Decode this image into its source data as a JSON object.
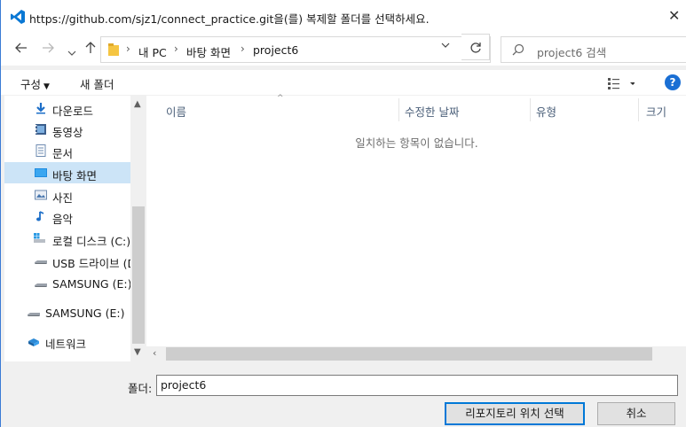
{
  "window": {
    "title": "https://github.com/sjz1/connect_practice.git을(를) 복제할 폴더를 선택하세요.",
    "close_glyph": "✕"
  },
  "nav": {
    "back_icon": "arrow-left-icon",
    "forward_icon": "arrow-right-icon",
    "recent_icon": "chevron-down-icon",
    "up_icon": "arrow-up-icon",
    "breadcrumbs": [
      "내 PC",
      "바탕 화면",
      "project6"
    ],
    "search_placeholder": "project6 검색"
  },
  "toolbar": {
    "organize_label": "구성",
    "new_folder_label": "새 폴더",
    "help_label": "?"
  },
  "sidebar": {
    "items": [
      {
        "label": "다운로드",
        "icon": "download-icon"
      },
      {
        "label": "동영상",
        "icon": "video-icon"
      },
      {
        "label": "문서",
        "icon": "document-icon"
      },
      {
        "label": "바탕 화면",
        "icon": "desktop-icon",
        "selected": true
      },
      {
        "label": "사진",
        "icon": "picture-icon"
      },
      {
        "label": "음악",
        "icon": "music-icon"
      },
      {
        "label": "로컬 디스크 (C:)",
        "icon": "local-disk-icon"
      },
      {
        "label": "USB 드라이브 (D",
        "icon": "usb-drive-icon"
      },
      {
        "label": "SAMSUNG (E:)",
        "icon": "drive-icon"
      },
      {
        "label": "SAMSUNG (E:)",
        "icon": "drive-icon"
      },
      {
        "label": "네트워크",
        "icon": "network-icon"
      }
    ]
  },
  "filelist": {
    "columns": [
      "이름",
      "수정한 날짜",
      "유형",
      "크기"
    ],
    "empty_message": "일치하는 항목이 없습니다."
  },
  "bottom": {
    "folder_label": "폴더:",
    "folder_value": "project6",
    "select_button": "리포지토리 위치 선택",
    "cancel_button": "취소"
  },
  "colors": {
    "accent": "#0078d7",
    "selected_bg": "#cce4f7",
    "help_blue": "#1a6fd4"
  }
}
